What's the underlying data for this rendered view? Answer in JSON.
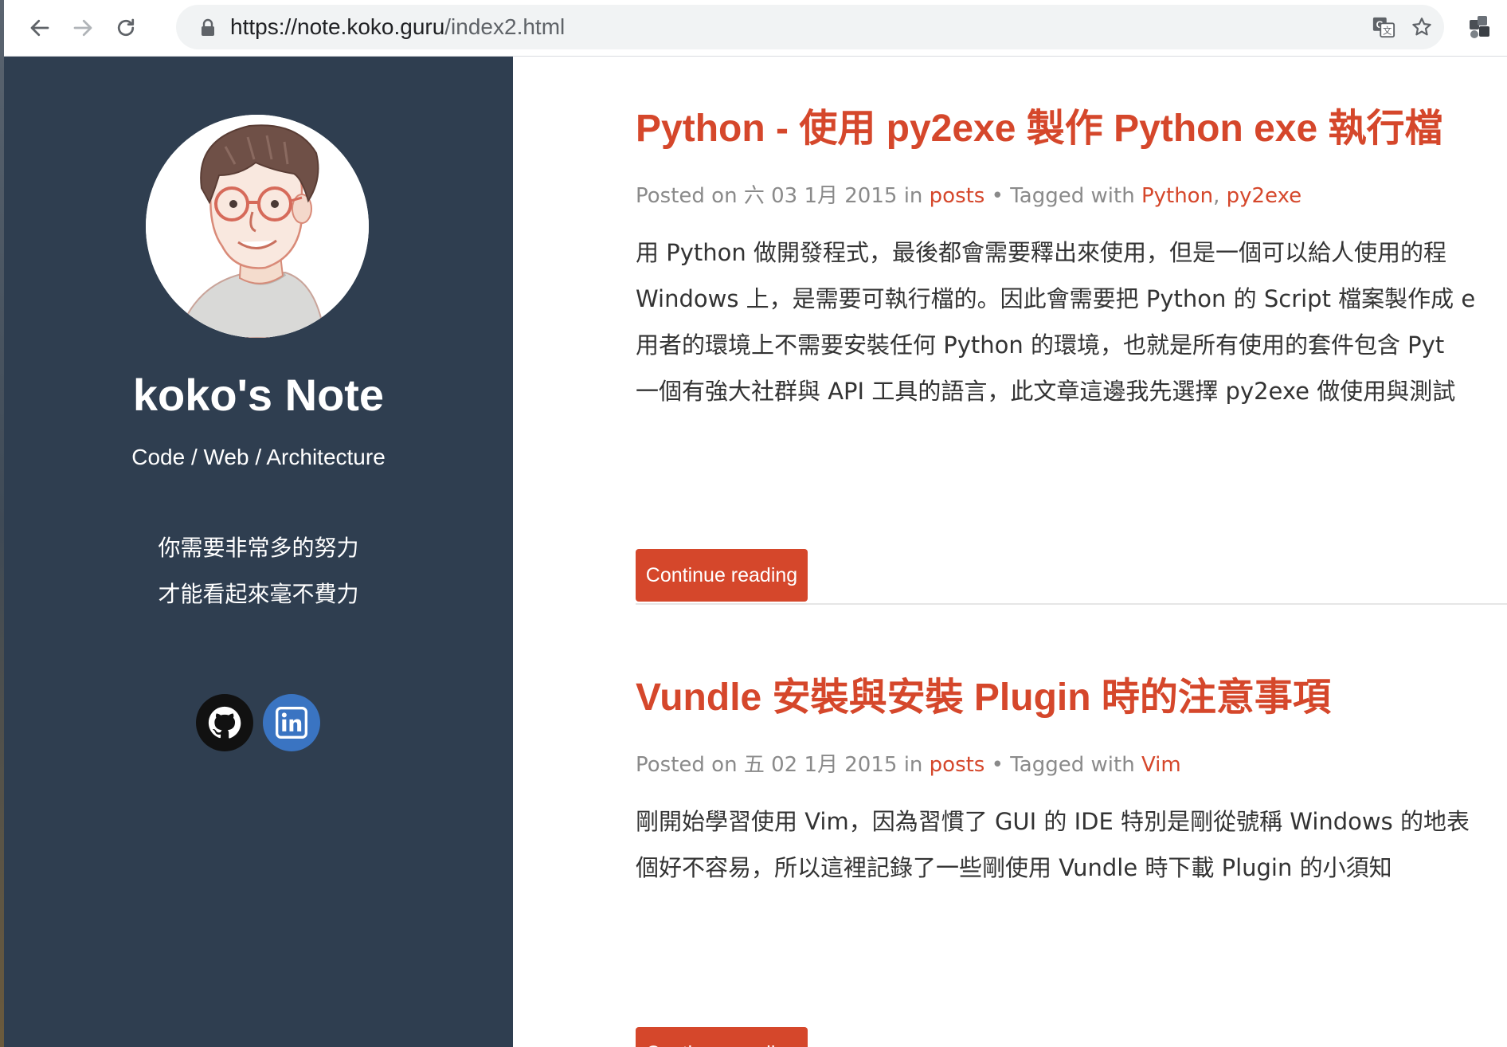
{
  "browser": {
    "url_host": "https://note.koko.guru",
    "url_path": "/index2.html",
    "icons": [
      "back-icon",
      "forward-icon",
      "reload-icon",
      "lock-icon",
      "translate-icon",
      "bookmark-star-icon",
      "extension-icon"
    ]
  },
  "sidebar": {
    "title": "koko's Note",
    "tagline": "Code / Web / Architecture",
    "motto_line1": "你需要非常多的努力",
    "motto_line2": "才能看起來毫不費力",
    "social": [
      {
        "name": "github",
        "icon": "github-icon",
        "color": "#111111"
      },
      {
        "name": "linkedin",
        "icon": "linkedin-icon",
        "color": "#3a74c2"
      }
    ],
    "background": "#2f3e50"
  },
  "posts": [
    {
      "title": "Python - 使用 py2exe 製作 Python exe 執行檔",
      "meta": {
        "posted_on": "Posted on",
        "date": "六 03 1月 2015",
        "in": "in",
        "category": "posts",
        "tagged": "• Tagged with",
        "tag1": "Python",
        "sep": ",",
        "tag2": "py2exe"
      },
      "excerpt": [
        "用 Python 做開發程式，最後都會需要釋出來使用，但是一個可以給人使用的程",
        "Windows 上，是需要可執行檔的。因此會需要把 Python 的 Script 檔案製作成 e",
        "用者的環境上不需要安裝任何 Python 的環境，也就是所有使用的套件包含 Pyt",
        "一個有強大社群與 API 工具的語言，此文章這邊我先選擇 py2exe 做使用與測試"
      ],
      "button": "Continue reading"
    },
    {
      "title": "Vundle 安裝與安裝 Plugin 時的注意事項",
      "meta": {
        "posted_on": "Posted on",
        "date": "五 02 1月 2015",
        "in": "in",
        "category": "posts",
        "tagged": "• Tagged with",
        "tag1": "Vim"
      },
      "excerpt": [
        "剛開始學習使用 Vim，因為習慣了 GUI 的 IDE 特別是剛從號稱 Windows 的地表",
        "個好不容易，所以這裡記錄了一些剛使用 Vundle 時下載 Plugin 的小須知"
      ],
      "button": "Continue reading"
    }
  ],
  "colors": {
    "accent": "#d5472b",
    "meta_gray": "#8a8a8a"
  }
}
